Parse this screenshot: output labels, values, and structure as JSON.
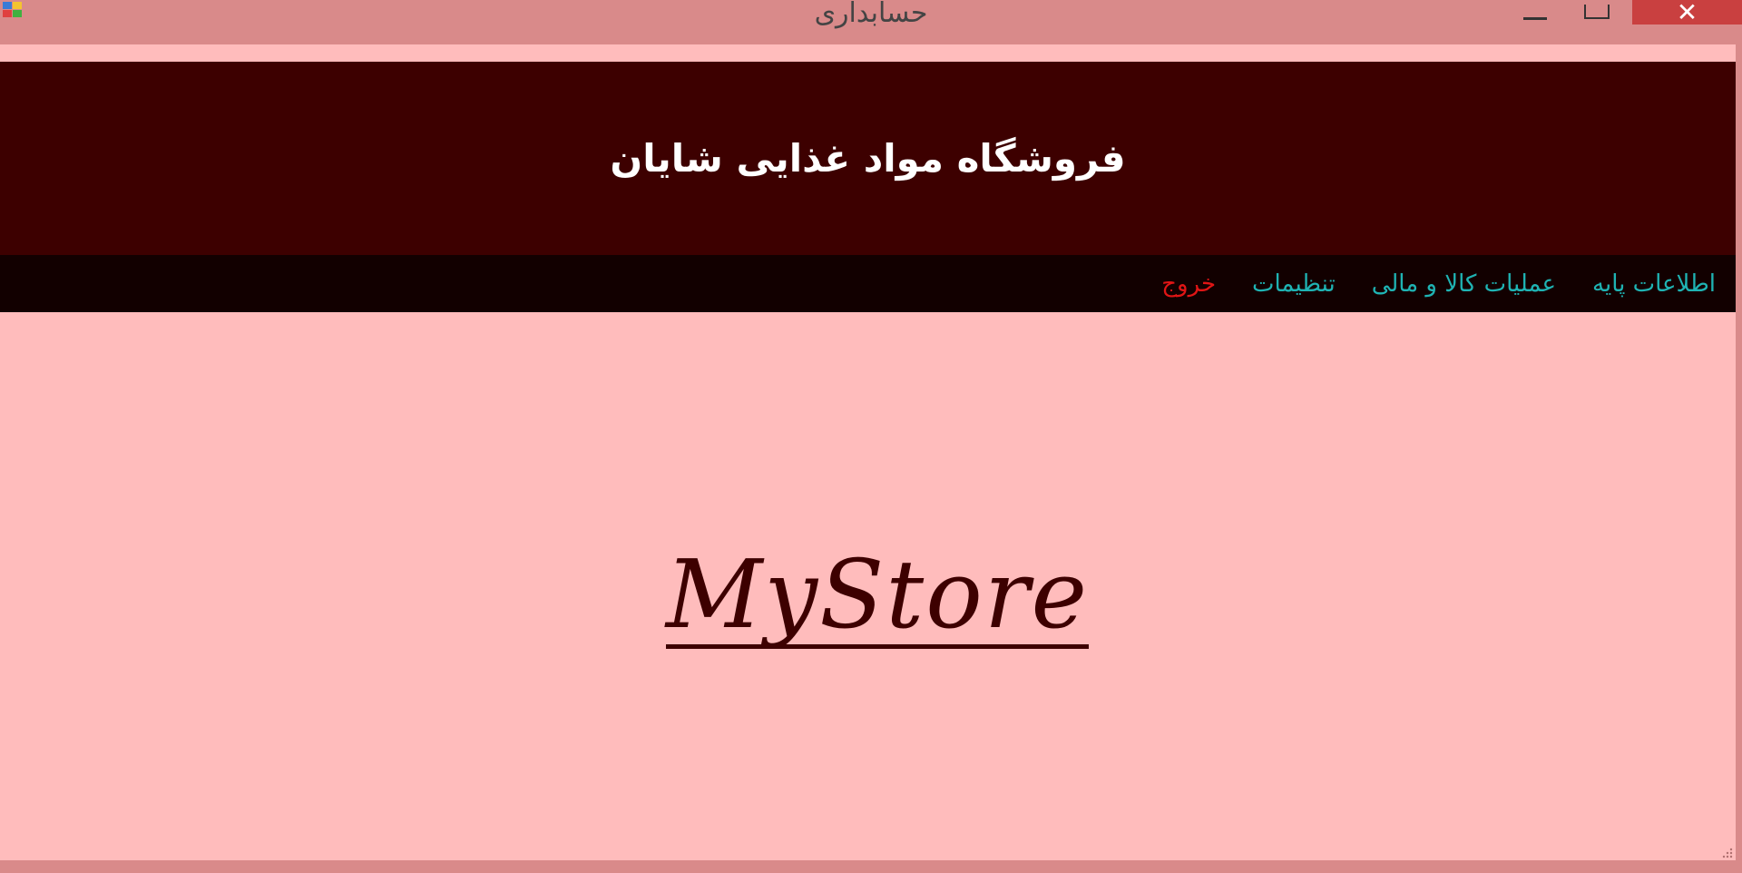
{
  "window": {
    "title": "حسابداری",
    "close_glyph": "✕"
  },
  "header": {
    "store_name": "فروشگاه مواد غذایی شایان"
  },
  "menu": {
    "items": [
      {
        "label": "اطلاعات پایه",
        "color": "#1fb3b3"
      },
      {
        "label": "عملیات کالا و مالی",
        "color": "#1fb3b3"
      },
      {
        "label": "تنظیمات",
        "color": "#1fb3b3"
      },
      {
        "label": "خروج",
        "color": "#e01515"
      }
    ]
  },
  "logo": {
    "text": "MyStore"
  },
  "colors": {
    "banner": "#3d0000",
    "menubar": "#120000",
    "background": "#ffbcbc",
    "frame": "#d98a8a",
    "close_button": "#c94040"
  }
}
